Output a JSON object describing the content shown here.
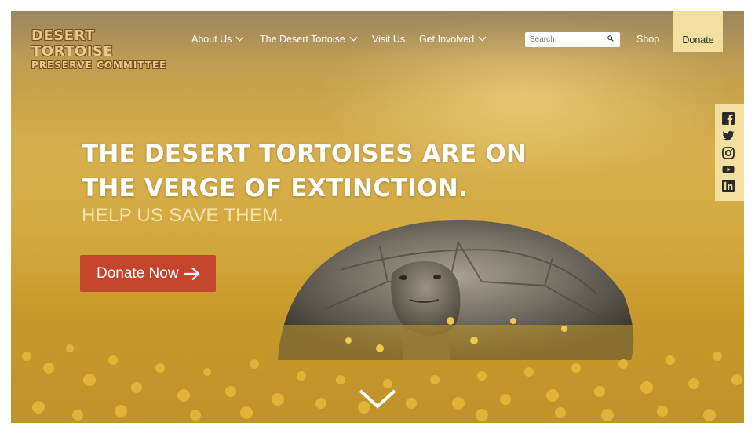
{
  "logo": {
    "line1": "DESERT TORTOISE",
    "line2": "PRESERVE COMMITTEE"
  },
  "nav": {
    "items": [
      {
        "label": "About Us",
        "has_dropdown": true
      },
      {
        "label": "The Desert Tortoise",
        "has_dropdown": true
      },
      {
        "label": "Visit Us",
        "has_dropdown": false
      },
      {
        "label": "Get Involved",
        "has_dropdown": true
      }
    ],
    "shop_label": "Shop",
    "donate_label": "Donate"
  },
  "search": {
    "placeholder": "Search",
    "value": "",
    "icon": "search-icon"
  },
  "social": {
    "icons": [
      "facebook-icon",
      "twitter-icon",
      "instagram-icon",
      "youtube-icon",
      "linkedin-icon"
    ]
  },
  "hero": {
    "headline_line1": "THE DESERT TORTOISES ARE ON",
    "headline_line2": "THE VERGE OF EXTINCTION.",
    "subheadline": "HELP US SAVE THEM.",
    "cta_label": "Donate Now",
    "cta_icon": "arrow-right-icon",
    "scroll_icon": "chevron-down-icon"
  },
  "colors": {
    "accent_donate_tab": "#f3dfa0",
    "cta_red": "#c4442c",
    "subheadline": "#f3e2b0",
    "logo_text": "#e8c98c"
  }
}
